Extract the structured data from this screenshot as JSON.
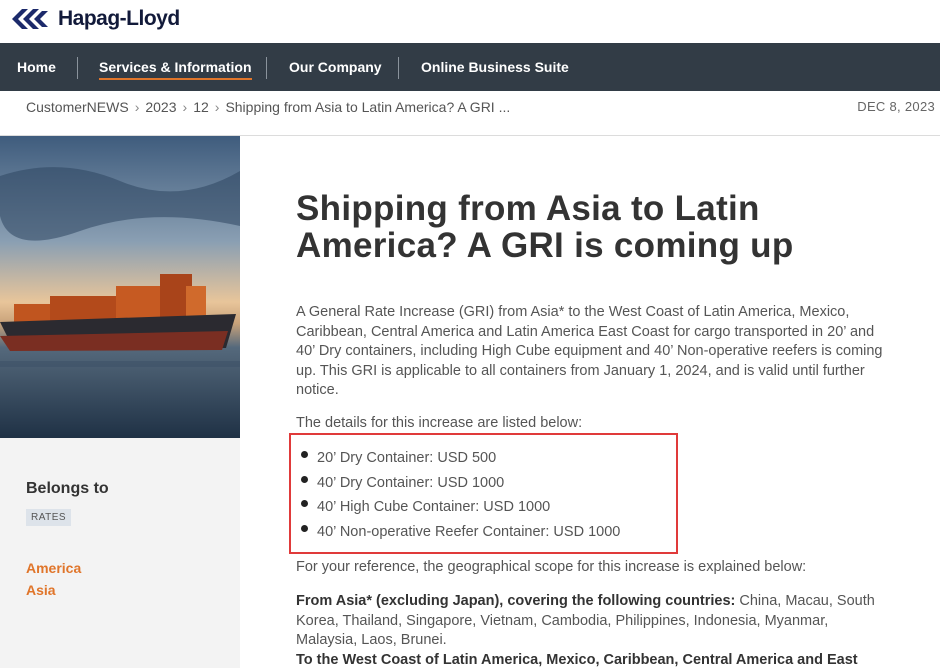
{
  "brand": {
    "name": "Hapag-Lloyd",
    "logo_color": "#1c2a6b"
  },
  "nav": {
    "items": [
      {
        "label": "Home"
      },
      {
        "label": "Services & Information",
        "active": true
      },
      {
        "label": "Our Company"
      },
      {
        "label": "Online Business Suite"
      }
    ],
    "active_underline_color": "#e0752a"
  },
  "breadcrumb": {
    "items": [
      "CustomerNEWS",
      "2023",
      "12",
      "Shipping from Asia to Latin America? A GRI ..."
    ],
    "date": "DEC 8, 2023"
  },
  "sidebar": {
    "belongs_label": "Belongs to",
    "tag": "RATES",
    "regions": [
      "America",
      "Asia"
    ]
  },
  "article": {
    "title": "Shipping from Asia to Latin America? A GRI is coming up",
    "intro": "A General Rate Increase (GRI) from Asia* to the West Coast of Latin America, Mexico, Caribbean, Central America and Latin America East Coast for cargo transported in 20’ and 40’ Dry containers, including High Cube equipment and 40’ Non-operative reefers is coming up. This GRI is applicable to all containers from January 1, 2024, and is valid until further notice.",
    "details_intro": "The details for this increase are listed below:",
    "increases": [
      "20’ Dry Container: USD 500",
      "40’ Dry Container: USD 1000",
      "40’ High Cube Container: USD 1000",
      "40’ Non-operative Reefer Container: USD 1000"
    ],
    "scope_intro": "For your reference, the geographical scope for this increase is explained below:",
    "from_label": "From Asia* (excluding Japan), covering the following countries:",
    "from_countries": " China, Macau, South Korea, Thailand, Singapore, Vietnam, Cambodia, Philippines, Indonesia, Myanmar, Malaysia, Laos, Brunei.",
    "to_label": "To the West Coast of Latin America, Mexico, Caribbean, Central America and East"
  }
}
